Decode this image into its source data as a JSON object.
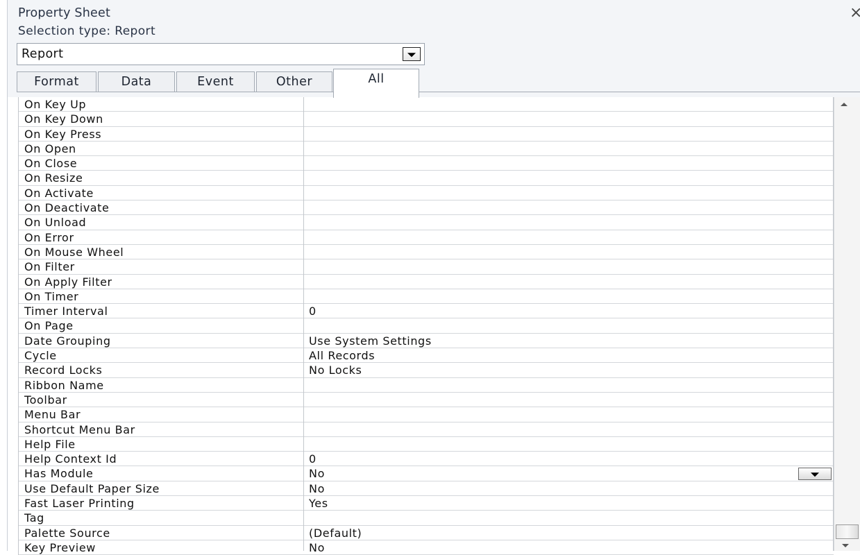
{
  "panel": {
    "title": "Property Sheet",
    "close": "×",
    "selection_type": "Selection type:  Report",
    "object_combo": "Report"
  },
  "tabs": [
    {
      "label": "Format"
    },
    {
      "label": "Data"
    },
    {
      "label": "Event"
    },
    {
      "label": "Other"
    },
    {
      "label": "All"
    }
  ],
  "active_tab": "All",
  "properties": [
    {
      "name": "On Key Up",
      "value": ""
    },
    {
      "name": "On Key Down",
      "value": ""
    },
    {
      "name": "On Key Press",
      "value": ""
    },
    {
      "name": "On Open",
      "value": ""
    },
    {
      "name": "On Close",
      "value": ""
    },
    {
      "name": "On Resize",
      "value": ""
    },
    {
      "name": "On Activate",
      "value": ""
    },
    {
      "name": "On Deactivate",
      "value": ""
    },
    {
      "name": "On Unload",
      "value": ""
    },
    {
      "name": "On Error",
      "value": ""
    },
    {
      "name": "On Mouse Wheel",
      "value": ""
    },
    {
      "name": "On Filter",
      "value": ""
    },
    {
      "name": "On Apply Filter",
      "value": ""
    },
    {
      "name": "On Timer",
      "value": ""
    },
    {
      "name": "Timer Interval",
      "value": "0"
    },
    {
      "name": "On Page",
      "value": ""
    },
    {
      "name": "Date Grouping",
      "value": "Use System Settings"
    },
    {
      "name": "Cycle",
      "value": "All Records"
    },
    {
      "name": "Record Locks",
      "value": "No Locks"
    },
    {
      "name": "Ribbon Name",
      "value": ""
    },
    {
      "name": "Toolbar",
      "value": ""
    },
    {
      "name": "Menu Bar",
      "value": ""
    },
    {
      "name": "Shortcut Menu Bar",
      "value": ""
    },
    {
      "name": "Help File",
      "value": ""
    },
    {
      "name": "Help Context Id",
      "value": "0"
    },
    {
      "name": "Has Module",
      "value": "No"
    },
    {
      "name": "Use Default Paper Size",
      "value": "No"
    },
    {
      "name": "Fast Laser Printing",
      "value": "Yes"
    },
    {
      "name": "Tag",
      "value": ""
    },
    {
      "name": "Palette Source",
      "value": "(Default)"
    },
    {
      "name": "Key Preview",
      "value": "No"
    }
  ],
  "icons": {
    "close": "close-icon",
    "combo_arrow": "chevron-down-icon",
    "scroll_up": "scroll-up-icon",
    "scroll_down": "scroll-down-icon"
  }
}
